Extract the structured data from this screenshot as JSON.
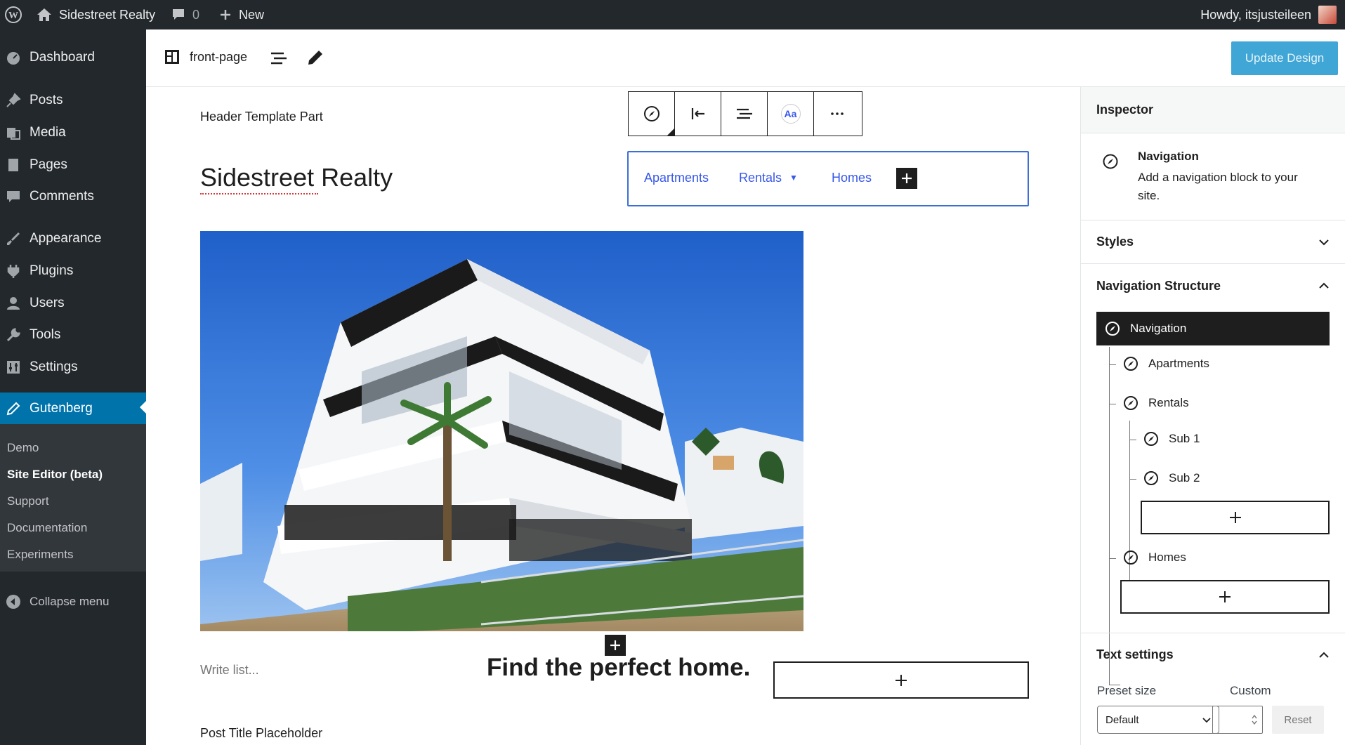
{
  "admin_bar": {
    "site_name": "Sidestreet Realty",
    "comment_count": "0",
    "new_label": "New",
    "howdy": "Howdy, itsjusteileen"
  },
  "sidebar": {
    "items": [
      {
        "label": "Dashboard",
        "icon": "dashboard-icon"
      },
      {
        "label": "Posts",
        "icon": "pin-icon"
      },
      {
        "label": "Media",
        "icon": "media-icon"
      },
      {
        "label": "Pages",
        "icon": "page-icon"
      },
      {
        "label": "Comments",
        "icon": "comment-icon"
      },
      {
        "label": "Appearance",
        "icon": "brush-icon"
      },
      {
        "label": "Plugins",
        "icon": "plugin-icon"
      },
      {
        "label": "Users",
        "icon": "user-icon"
      },
      {
        "label": "Tools",
        "icon": "wrench-icon"
      },
      {
        "label": "Settings",
        "icon": "settings-icon"
      },
      {
        "label": "Gutenberg",
        "icon": "pencil-icon"
      }
    ],
    "submenu": [
      "Demo",
      "Site Editor (beta)",
      "Support",
      "Documentation",
      "Experiments"
    ],
    "collapse_label": "Collapse menu"
  },
  "editor_header": {
    "template_name": "front-page",
    "update_button": "Update Design"
  },
  "canvas": {
    "template_part_label": "Header Template Part",
    "site_title": "Sidestreet Realty",
    "nav_links": [
      "Apartments",
      "Rentals",
      "Homes"
    ],
    "write_list": "Write list...",
    "heading": "Find the perfect home.",
    "post_title": "Post Title Placeholder",
    "toolbar_aa": "Aa"
  },
  "inspector": {
    "title": "Inspector",
    "block_name": "Navigation",
    "block_description": "Add a navigation block to your site.",
    "styles_label": "Styles",
    "nav_structure_label": "Navigation Structure",
    "tree": {
      "root": "Navigation",
      "items": [
        "Apartments",
        "Rentals",
        "Sub 1",
        "Sub 2",
        "Homes"
      ]
    },
    "text_settings": {
      "label": "Text settings",
      "preset_label": "Preset size",
      "custom_label": "Custom",
      "preset_value": "Default",
      "reset_label": "Reset"
    }
  },
  "colors": {
    "admin_dark": "#23282d",
    "accent": "#0073aa",
    "link": "#3858e9",
    "update_button": "#3fa6d6"
  }
}
